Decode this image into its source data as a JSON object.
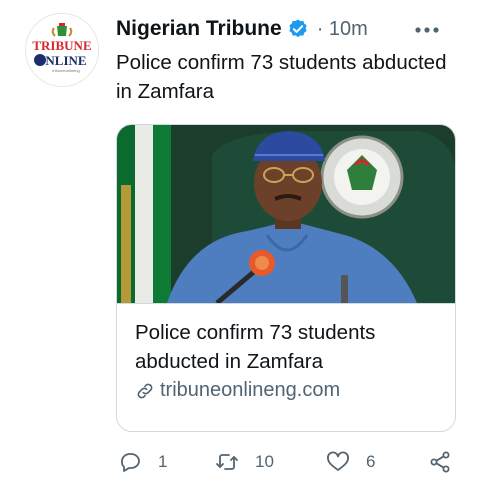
{
  "author": {
    "name": "Nigerian Tribune",
    "timestamp": "· 10m",
    "avatar_text_top": "TRIBUNE",
    "avatar_text_bottom": "NLINE",
    "avatar_text_small": "tribuneonlineng"
  },
  "tweet": {
    "text": "Police confirm 73 students abducted in Zamfara"
  },
  "card": {
    "title": "Police confirm 73 students abducted in Zamfara",
    "domain": "tribuneonlineng.com"
  },
  "actions": {
    "replies": "1",
    "retweets": "10",
    "likes": "6"
  },
  "icons": {
    "verified": "verified-badge-icon",
    "more": "more-dots-icon",
    "link": "link-icon",
    "reply": "reply-icon",
    "retweet": "retweet-icon",
    "like": "heart-icon",
    "share": "share-icon"
  },
  "colors": {
    "verified_blue": "#1d9bf0",
    "muted_text": "#536471",
    "brand_red": "#d7262b"
  }
}
